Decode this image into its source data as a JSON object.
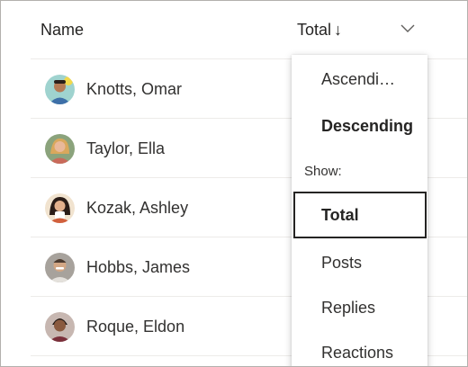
{
  "table": {
    "columns": {
      "name": "Name",
      "total": "Total",
      "sort_arrow": "↓"
    },
    "rows": [
      {
        "name": "Knotts, Omar"
      },
      {
        "name": "Taylor, Ella"
      },
      {
        "name": "Kozak, Ashley"
      },
      {
        "name": "Hobbs, James"
      },
      {
        "name": "Roque, Eldon"
      }
    ]
  },
  "sort_menu": {
    "items": [
      {
        "label": "Ascendi…"
      },
      {
        "label": "Descending"
      }
    ],
    "show_header": "Show:",
    "show_items": [
      {
        "label": "Total",
        "selected": true
      },
      {
        "label": "Posts"
      },
      {
        "label": "Replies"
      },
      {
        "label": "Reactions"
      }
    ]
  },
  "icons": {
    "column_menu": "chevron-down-icon"
  }
}
